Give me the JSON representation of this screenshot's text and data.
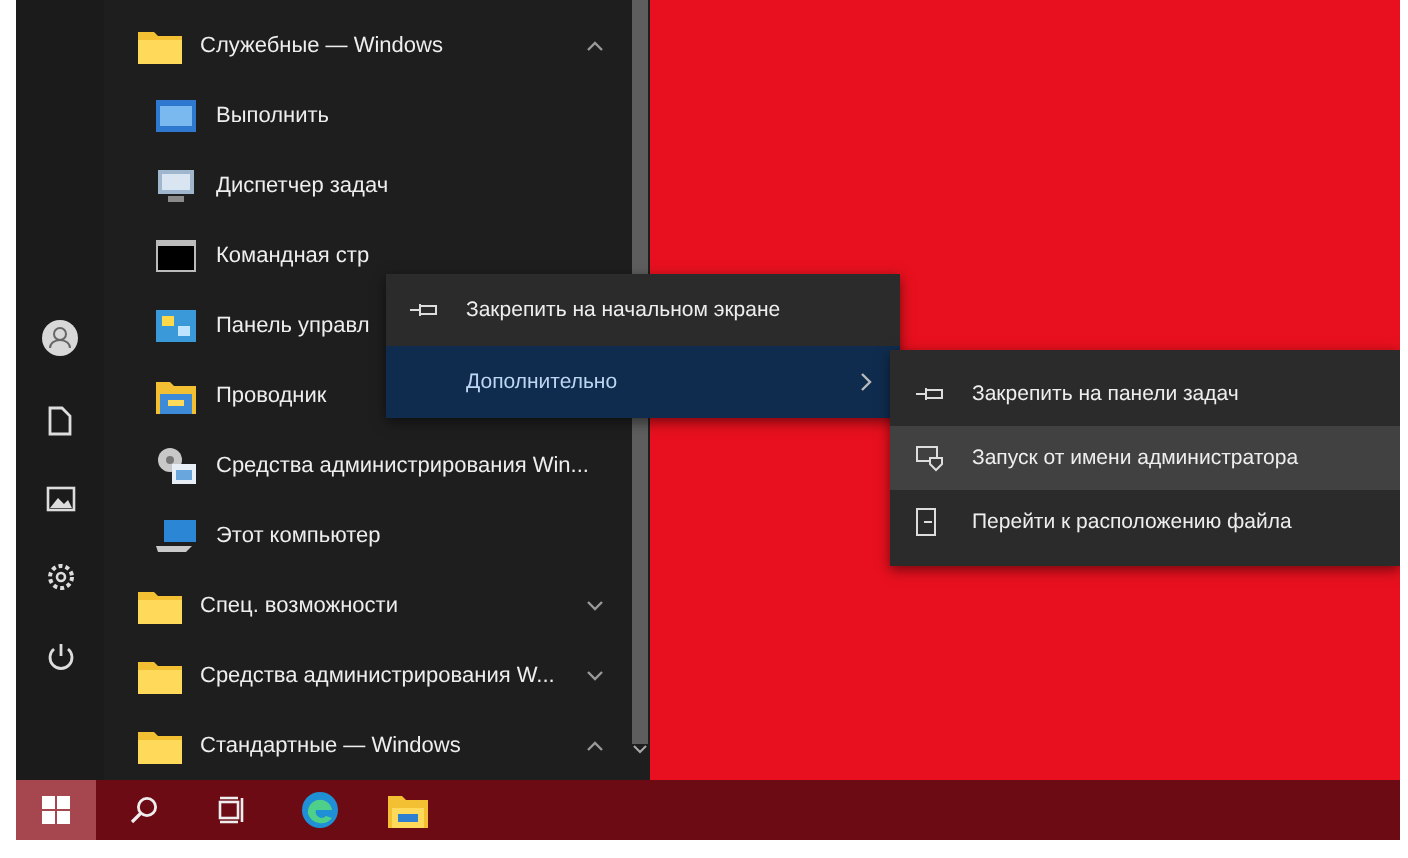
{
  "start_menu": {
    "apps": [
      {
        "kind": "folder",
        "label": "Служебные — Windows",
        "expanded": true
      },
      {
        "kind": "run",
        "label": "Выполнить"
      },
      {
        "kind": "taskmgr",
        "label": "Диспетчер задач"
      },
      {
        "kind": "cmd",
        "label": "Командная стр"
      },
      {
        "kind": "control",
        "label": "Панель управл"
      },
      {
        "kind": "explorer",
        "label": "Проводник"
      },
      {
        "kind": "admin",
        "label": "Средства администрирования Win..."
      },
      {
        "kind": "computer",
        "label": "Этот компьютер"
      },
      {
        "kind": "folder",
        "label": "Спец. возможности",
        "expanded": false
      },
      {
        "kind": "folder",
        "label": "Средства администрирования W...",
        "expanded": false
      },
      {
        "kind": "folder",
        "label": "Стандартные — Windows",
        "expanded": true
      }
    ]
  },
  "context_menu": {
    "items": [
      {
        "kind": "pin",
        "label": "Закрепить на начальном экране",
        "selected": false,
        "submenu": false
      },
      {
        "kind": "none",
        "label": "Дополнительно",
        "selected": true,
        "submenu": true
      }
    ]
  },
  "submenu": {
    "items": [
      {
        "kind": "pin",
        "label": "Закрепить на панели задач",
        "selected": false
      },
      {
        "kind": "shield",
        "label": "Запуск от имени администратора",
        "selected": true
      },
      {
        "kind": "file",
        "label": "Перейти к расположению файла",
        "selected": false
      }
    ]
  },
  "taskbar": {
    "items": [
      {
        "kind": "start",
        "selected": true
      },
      {
        "kind": "search",
        "selected": false
      },
      {
        "kind": "taskview",
        "selected": false
      },
      {
        "kind": "edge",
        "selected": false
      },
      {
        "kind": "explorer",
        "selected": false
      }
    ]
  }
}
